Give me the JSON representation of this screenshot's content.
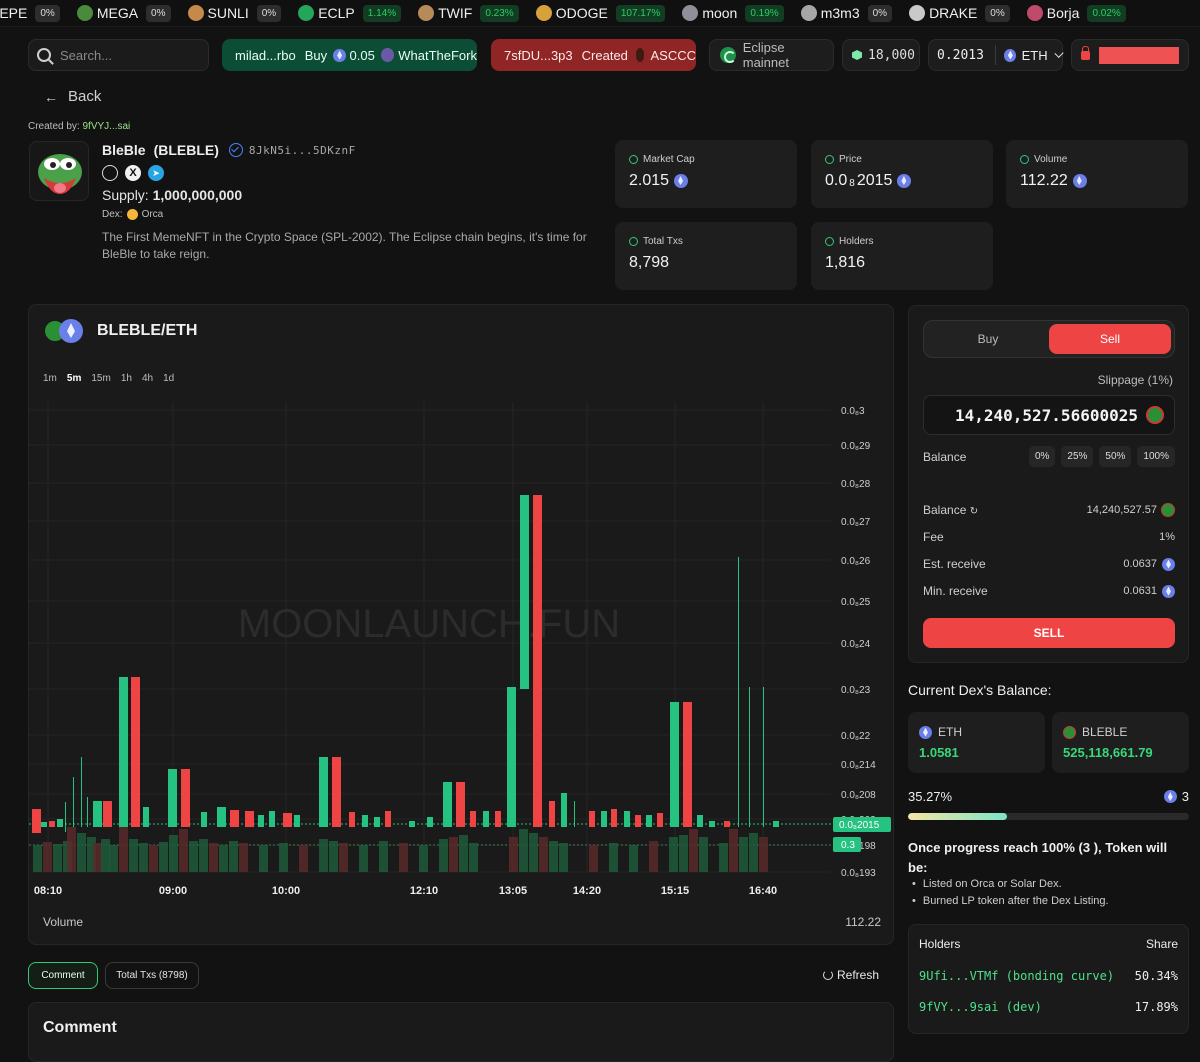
{
  "ticker": [
    {
      "sym": "PEPE",
      "pct": "0%",
      "up": false,
      "color": "#3f9e44"
    },
    {
      "sym": "MEGA",
      "pct": "0%",
      "up": false,
      "color": "#4a8a3c"
    },
    {
      "sym": "SUNLI",
      "pct": "0%",
      "up": false,
      "color": "#c58a4a"
    },
    {
      "sym": "ECLP",
      "pct": "1.14%",
      "up": true,
      "color": "#23a55a"
    },
    {
      "sym": "TWIF",
      "pct": "0.23%",
      "up": true,
      "color": "#b78a5a"
    },
    {
      "sym": "ODOGE",
      "pct": "107.17%",
      "up": true,
      "color": "#d6a03a"
    },
    {
      "sym": "moon",
      "pct": "0.19%",
      "up": true,
      "color": "#8f8f9a"
    },
    {
      "sym": "m3m3",
      "pct": "0%",
      "up": false,
      "color": "#a6a6a6"
    },
    {
      "sym": "DRAKE",
      "pct": "0%",
      "up": false,
      "color": "#c9c9c9"
    },
    {
      "sym": "Borja",
      "pct": "0.02%",
      "up": true,
      "color": "#c04a6a"
    }
  ],
  "header": {
    "search_placeholder": "Search...",
    "activity_buy": {
      "user": "milad...rbo",
      "action": "Buy",
      "amount": "0.05",
      "token": "WhatTheFork"
    },
    "activity_create": {
      "user": "7sfDU...3p3",
      "action": "Created",
      "token": "ASCCC"
    },
    "network": "Eclipse mainnet",
    "points": "18,000",
    "eth_balance": "0.2013",
    "currency": "ETH"
  },
  "nav": {
    "back": "Back"
  },
  "creator": {
    "label": "Created by:",
    "address": "9fVYJ...sai"
  },
  "token": {
    "name": "BleBle",
    "symbol": "(BLEBLE)",
    "mint": "8JkN5i...5DKznF",
    "supply_label": "Supply:",
    "supply": "1,000,000,000",
    "dex_label": "Dex:",
    "dex": "Orca",
    "description": "The First MemeNFT in the Crypto Space (SPL-2002). The Eclipse chain begins, it's time for BleBle to take reign."
  },
  "stats": {
    "market_cap": {
      "label": "Market Cap",
      "value": "2.015"
    },
    "price": {
      "label": "Price",
      "value_a": "0.0",
      "value_sub": "8",
      "value_b": "2015"
    },
    "volume": {
      "label": "Volume",
      "value": "112.22"
    },
    "total_txs": {
      "label": "Total Txs",
      "value": "8,798"
    },
    "holders": {
      "label": "Holders",
      "value": "1,816"
    }
  },
  "chart": {
    "pair": "BLEBLE/ETH",
    "timeframes": [
      "1m",
      "5m",
      "15m",
      "1h",
      "4h",
      "1d"
    ],
    "active_timeframe": "5m",
    "watermark": "MOONLAUNCH.FUN",
    "volume_label": "Volume",
    "volume_value": "112.22",
    "price_tag": "0.0₈2015",
    "vol_tag": "0.3"
  },
  "chart_data": {
    "type": "candlestick",
    "x_ticks": [
      "08:10",
      "09:00",
      "10:00",
      "12:10",
      "13:05",
      "14:20",
      "15:15",
      "16:40"
    ],
    "y_ticks": [
      "0.0₈3",
      "0.0₈29",
      "0.0₈28",
      "0.0₈27",
      "0.0₈26",
      "0.0₈25",
      "0.0₈24",
      "0.0₈23",
      "0.0₈22",
      "0.0₈214",
      "0.0₈208",
      "0.0₈203",
      "0.0₈198",
      "0.0₈193"
    ],
    "last_price": "0.0₈2015",
    "colors": {
      "up": "#26c281",
      "down": "#ef4444"
    }
  },
  "tabs": {
    "comment": "Comment",
    "total_txs": "Total Txs (8798)",
    "refresh": "Refresh"
  },
  "comments": {
    "title": "Comment"
  },
  "trade": {
    "buy": "Buy",
    "sell": "Sell",
    "slippage": "Slippage (1%)",
    "amount": "14,240,527.56600025",
    "balance_label": "Balance",
    "pct_buttons": [
      "0%",
      "25%",
      "50%",
      "100%"
    ],
    "balance2_label": "Balance",
    "balance2_value": "14,240,527.57",
    "fee_label": "Fee",
    "fee_value": "1%",
    "est_label": "Est. receive",
    "est_value": "0.0637",
    "min_label": "Min. receive",
    "min_value": "0.0631",
    "sell_button": "SELL"
  },
  "dex_balance": {
    "title": "Current Dex's Balance:",
    "eth_label": "ETH",
    "eth_value": "1.0581",
    "token_label": "BLEBLE",
    "token_value": "525,118,661.79"
  },
  "progress": {
    "percent_text": "35.27%",
    "percent": 35.27,
    "goal": "3",
    "note": "Once progress reach 100% (3 ), Token will be:",
    "bullets": [
      "Listed on Orca or Solar Dex.",
      "Burned LP token after the Dex Listing."
    ]
  },
  "holders_table": {
    "col_holders": "Holders",
    "col_share": "Share",
    "rows": [
      {
        "addr": "9Ufi...VTMf (bonding curve)",
        "share": "50.34%"
      },
      {
        "addr": "9fVY...9sai (dev)",
        "share": "17.89%"
      }
    ]
  }
}
